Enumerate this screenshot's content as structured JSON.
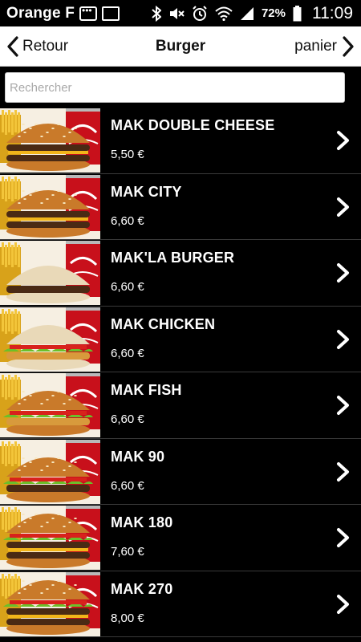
{
  "status_bar": {
    "carrier": "Orange F",
    "battery": "72%",
    "time": "11:09"
  },
  "nav": {
    "back_label": "Retour",
    "title": "Burger",
    "cart_label": "panier"
  },
  "search": {
    "placeholder": "Rechercher",
    "value": ""
  },
  "menu_items": [
    {
      "name": "MAK DOUBLE CHEESE",
      "price": "5,50 €",
      "variant": "double-cheese"
    },
    {
      "name": "MAK CITY",
      "price": "6,60 €",
      "variant": "city"
    },
    {
      "name": "MAK'LA BURGER",
      "price": "6,60 €",
      "variant": "la"
    },
    {
      "name": "MAK CHICKEN",
      "price": "6,60 €",
      "variant": "chicken"
    },
    {
      "name": "MAK FISH",
      "price": "6,60 €",
      "variant": "fish"
    },
    {
      "name": "MAK 90",
      "price": "6,60 €",
      "variant": "mak90"
    },
    {
      "name": "MAK 180",
      "price": "7,60 €",
      "variant": "mak180"
    },
    {
      "name": "MAK 270",
      "price": "8,00 €",
      "variant": "mak270"
    }
  ],
  "colors": {
    "list_background": "#000000",
    "nav_background": "#ffffff",
    "text_on_dark": "#ffffff"
  }
}
